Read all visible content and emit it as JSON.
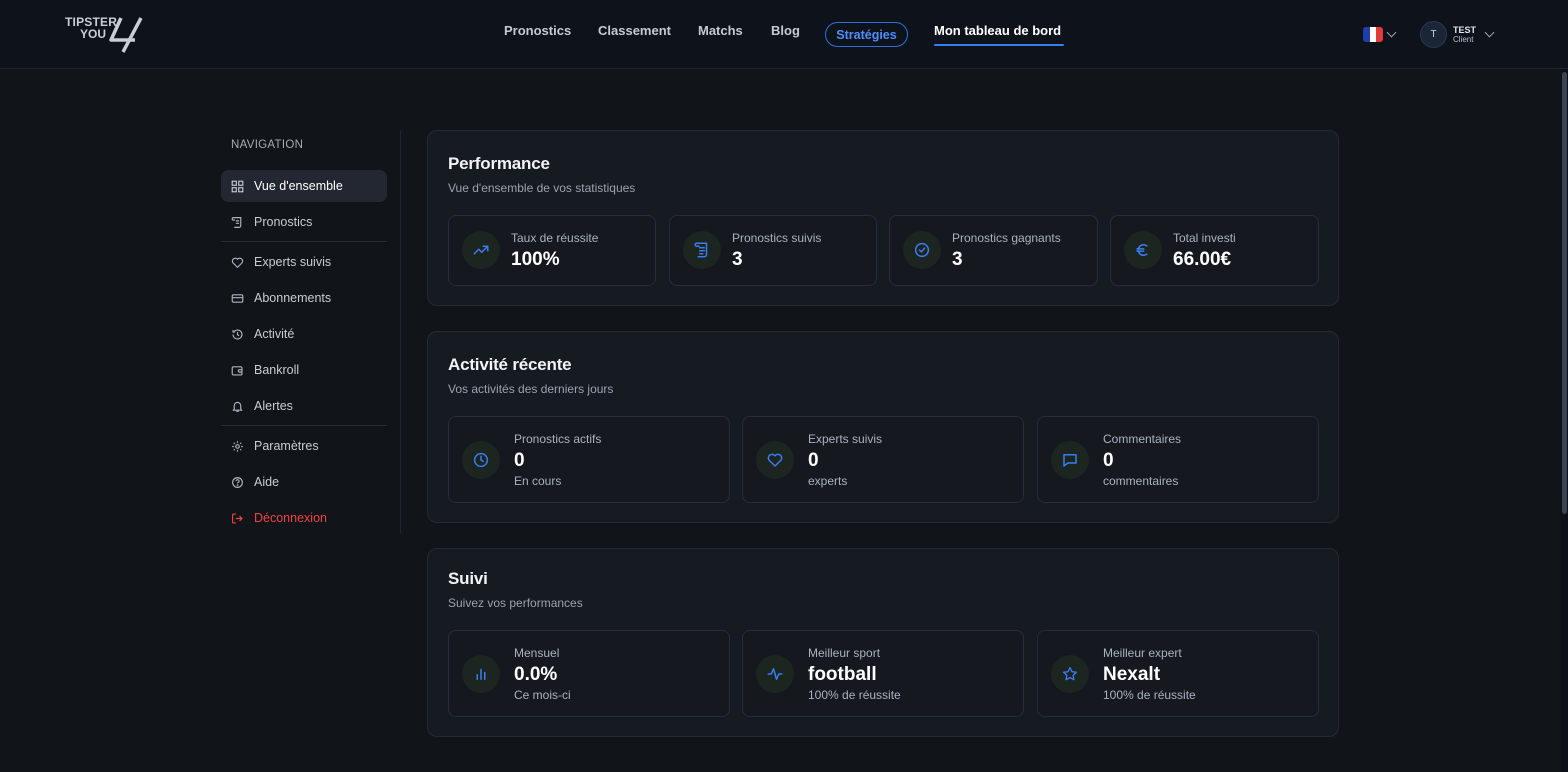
{
  "brand": {
    "line1": "TIPSTER",
    "line2": "YOU"
  },
  "nav": {
    "links": [
      "Pronostics",
      "Classement",
      "Matchs",
      "Blog"
    ],
    "strategies": "Stratégies",
    "dashboard": "Mon tableau de bord"
  },
  "language": {
    "flag": "fr",
    "colors": [
      "#1f3fa8",
      "#ffffff",
      "#e03a3a"
    ]
  },
  "user": {
    "initial": "T",
    "name": "TEST",
    "role": "Client"
  },
  "sidebar": {
    "title": "NAVIGATION",
    "items": [
      {
        "label": "Vue d'ensemble",
        "icon": "dashboard-icon"
      },
      {
        "label": "Pronostics",
        "icon": "scroll-icon"
      },
      {
        "label": "Experts suivis",
        "icon": "heart-icon"
      },
      {
        "label": "Abonnements",
        "icon": "credit-card-icon"
      },
      {
        "label": "Activité",
        "icon": "history-icon"
      },
      {
        "label": "Bankroll",
        "icon": "wallet-icon"
      },
      {
        "label": "Alertes",
        "icon": "bell-icon"
      },
      {
        "label": "Paramètres",
        "icon": "gear-icon"
      },
      {
        "label": "Aide",
        "icon": "help-icon"
      },
      {
        "label": "Déconnexion",
        "icon": "logout-icon"
      }
    ]
  },
  "performance": {
    "title": "Performance",
    "subtitle": "Vue d'ensemble de vos statistiques",
    "stats": [
      {
        "label": "Taux de réussite",
        "value": "100%",
        "icon": "trending-up-icon"
      },
      {
        "label": "Pronostics suivis",
        "value": "3",
        "icon": "scroll-icon"
      },
      {
        "label": "Pronostics gagnants",
        "value": "3",
        "icon": "check-circle-icon"
      },
      {
        "label": "Total investi",
        "value": "66.00€",
        "icon": "euro-icon"
      }
    ]
  },
  "activity": {
    "title": "Activité récente",
    "subtitle": "Vos activités des derniers jours",
    "stats": [
      {
        "label": "Pronostics actifs",
        "value": "0",
        "foot": "En cours",
        "icon": "clock-icon"
      },
      {
        "label": "Experts suivis",
        "value": "0",
        "foot": "experts",
        "icon": "heart-icon"
      },
      {
        "label": "Commentaires",
        "value": "0",
        "foot": "commentaires",
        "icon": "message-icon"
      }
    ]
  },
  "tracking": {
    "title": "Suivi",
    "subtitle": "Suivez vos performances",
    "stats": [
      {
        "label": "Mensuel",
        "value": "0.0%",
        "foot": "Ce mois-ci",
        "icon": "bar-chart-icon"
      },
      {
        "label": "Meilleur sport",
        "value": "football",
        "foot": "100% de réussite",
        "icon": "activity-icon"
      },
      {
        "label": "Meilleur expert",
        "value": "Nexalt",
        "foot": "100% de réussite",
        "icon": "star-icon"
      }
    ]
  },
  "colors": {
    "accent": "#3b7cf0",
    "danger": "#ef4444",
    "background": "#111418",
    "card": "#161a21"
  }
}
